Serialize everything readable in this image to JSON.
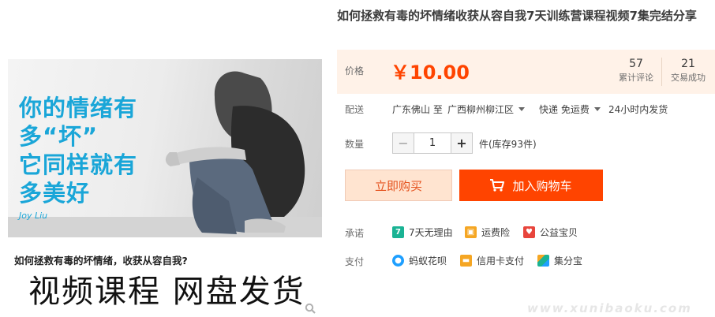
{
  "product": {
    "title": "如何拯救有毒的坏情绪收获从容自我7天训练营课程视频7集完结分享"
  },
  "image": {
    "lines": [
      "你的情绪有",
      "多“坏”",
      "它同样就有",
      "多美好"
    ],
    "signature": "Joy Liu",
    "caption": "如何拯救有毒的坏情绪，收获从容自我?",
    "big_text": "视频课程 网盘发货"
  },
  "price": {
    "label": "价格",
    "value": "￥10.00",
    "reviews_count": "57",
    "reviews_label": "累计评论",
    "sales_count": "21",
    "sales_label": "交易成功"
  },
  "delivery": {
    "label": "配送",
    "from": "广东佛山 至",
    "to": "广西柳州柳江区",
    "method": "快递 免运费",
    "ship_time": "24小时内发货"
  },
  "quantity": {
    "label": "数量",
    "value": "1",
    "minus": "−",
    "plus": "+",
    "stock": "件(库存93件)"
  },
  "buttons": {
    "buy_now": "立即购买",
    "add_to_cart": "加入购物车"
  },
  "promise": {
    "label": "承诺",
    "items": [
      "7天无理由",
      "运费险",
      "公益宝贝"
    ]
  },
  "payment": {
    "label": "支付",
    "items": [
      "蚂蚁花呗",
      "信用卡支付",
      "集分宝"
    ]
  },
  "watermark": "www.xunibaoku.com",
  "colors": {
    "accent": "#ff4400",
    "price_bg": "#fff2e8",
    "image_text": "#1aa6d8"
  }
}
